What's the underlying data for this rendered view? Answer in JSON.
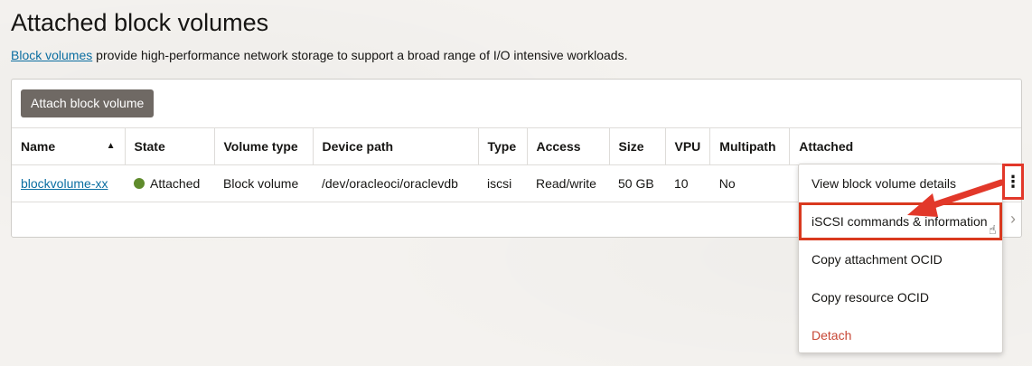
{
  "page": {
    "title": "Attached block volumes",
    "subtitle_link": "Block volumes",
    "subtitle_rest": " provide high-performance network storage to support a broad range of I/O intensive workloads."
  },
  "toolbar": {
    "attach_label": "Attach block volume"
  },
  "table": {
    "headers": [
      "Name",
      "State",
      "Volume type",
      "Device path",
      "Type",
      "Access",
      "Size",
      "VPU",
      "Multipath",
      "Attached"
    ],
    "sort": {
      "column": "Name",
      "direction": "ascending"
    },
    "rows": [
      {
        "name": "blockvolume-xx",
        "state": "Attached",
        "state_color": "#5f8b2c",
        "volume_type": "Block volume",
        "device_path": "/dev/oracleoci/oraclevdb",
        "type": "iscsi",
        "access": "Read/write",
        "size": "50 GB",
        "vpu": "10",
        "multipath": "No",
        "attached": ""
      }
    ]
  },
  "menu": {
    "items": [
      {
        "label": "View block volume details"
      },
      {
        "label": "iSCSI commands & information",
        "highlighted": true
      },
      {
        "label": "Copy attachment OCID"
      },
      {
        "label": "Copy resource OCID"
      },
      {
        "label": "Detach",
        "danger": true
      }
    ]
  },
  "icons": {
    "kebab": "kebab-menu-icon",
    "sort": "sort-ascending-icon",
    "chevron": "chevron-right-icon",
    "cursor": "hand-pointer-icon"
  },
  "colors": {
    "link": "#0b6ea1",
    "button": "#6f6964",
    "annotation": "#e2382a",
    "danger": "#c74634"
  }
}
